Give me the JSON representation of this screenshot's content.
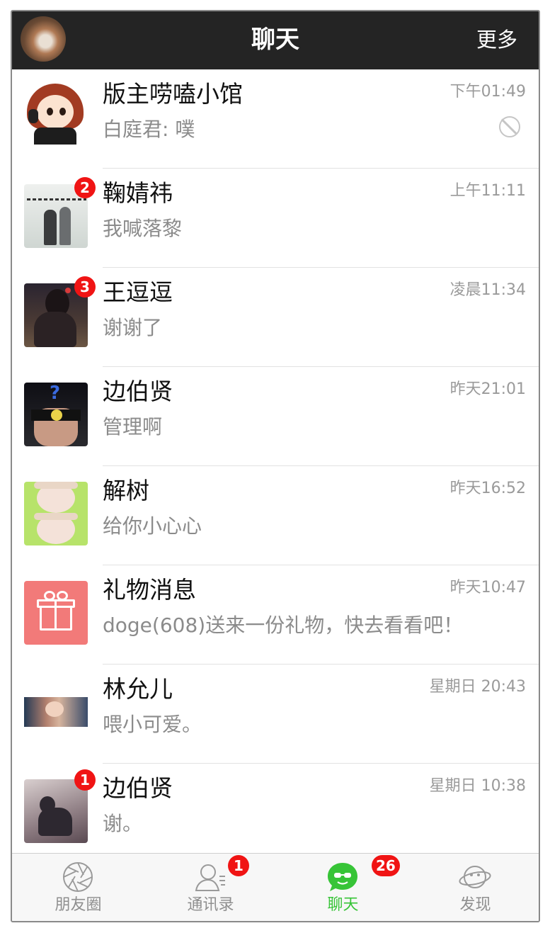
{
  "header": {
    "title": "聊天",
    "more": "更多"
  },
  "chats": [
    {
      "name": "版主唠嗑小馆",
      "message": "白庭君: 噗",
      "time": "下午01:49",
      "badge": "",
      "muted": true
    },
    {
      "name": "鞠婧祎",
      "message": "我喊落黎",
      "time": "上午11:11",
      "badge": "2"
    },
    {
      "name": "王逗逗",
      "message": "谢谢了",
      "time": "凌晨11:34",
      "badge": "3"
    },
    {
      "name": "边伯贤",
      "message": "管理啊",
      "time": "昨天21:01",
      "badge": ""
    },
    {
      "name": "解树",
      "message": "给你小心心",
      "time": "昨天16:52",
      "badge": ""
    },
    {
      "name": "礼物消息",
      "message": "doge(608)送来一份礼物，快去看看吧！",
      "time": "昨天10:47",
      "badge": ""
    },
    {
      "name": "林允儿",
      "message": "喂小可爱。",
      "time": "星期日 20:43",
      "badge": ""
    },
    {
      "name": "边伯贤",
      "message": "谢。",
      "time": "星期日 10:38",
      "badge": "1"
    }
  ],
  "tabs": [
    {
      "label": "朋友圈",
      "icon": "moments-icon",
      "badge": ""
    },
    {
      "label": "通讯录",
      "icon": "contacts-icon",
      "badge": "1"
    },
    {
      "label": "聊天",
      "icon": "chat-icon",
      "badge": "26",
      "active": true
    },
    {
      "label": "发现",
      "icon": "planet-icon",
      "badge": ""
    }
  ],
  "colors": {
    "header_bg": "#242424",
    "badge": "#f01414",
    "active_tab": "#37c437",
    "gift": "#f27a79"
  }
}
